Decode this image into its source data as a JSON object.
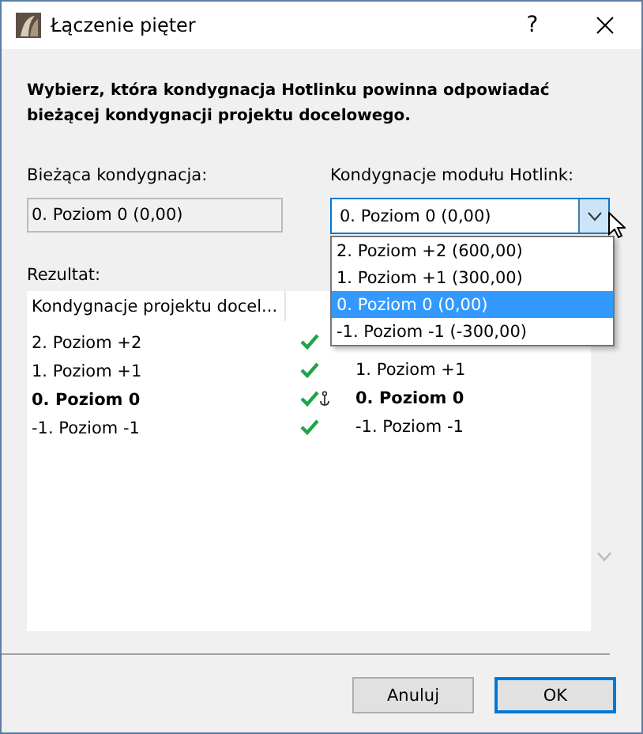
{
  "window": {
    "title": "Łączenie pięter",
    "help": "?"
  },
  "instruction": "Wybierz, która kondygnacja Hotlinku powinna odpowiadać bieżącej kondygnacji projektu docelowego.",
  "current_level": {
    "label": "Bieżąca kondygnacja:",
    "value": "0. Poziom 0 (0,00)"
  },
  "hotlink_levels": {
    "label": "Kondygnacje modułu Hotlink:",
    "value": "0. Poziom 0 (0,00)",
    "expanded": true,
    "options": [
      {
        "label": "2. Poziom +2 (600,00)",
        "selected": false
      },
      {
        "label": "1. Poziom +1 (300,00)",
        "selected": false
      },
      {
        "label": "0. Poziom 0 (0,00)",
        "selected": true
      },
      {
        "label": "-1. Poziom -1 (-300,00)",
        "selected": false
      }
    ]
  },
  "result": {
    "label": "Rezultat:",
    "columns": [
      "Kondygnacje projektu docel..."
    ],
    "rows": [
      {
        "target": "2. Poziom +2",
        "matched": true,
        "anchored": false,
        "current": false
      },
      {
        "target": "1. Poziom +1",
        "matched": true,
        "anchored": false,
        "current": false,
        "source": "1. Poziom +1"
      },
      {
        "target": "0. Poziom 0",
        "matched": true,
        "anchored": true,
        "current": true,
        "source": "0. Poziom 0"
      },
      {
        "target": "-1. Poziom -1",
        "matched": true,
        "anchored": false,
        "current": false,
        "source": "-1. Poziom -1"
      }
    ]
  },
  "buttons": [
    {
      "label": "Anuluj",
      "default": false
    },
    {
      "label": "OK",
      "default": true
    }
  ]
}
